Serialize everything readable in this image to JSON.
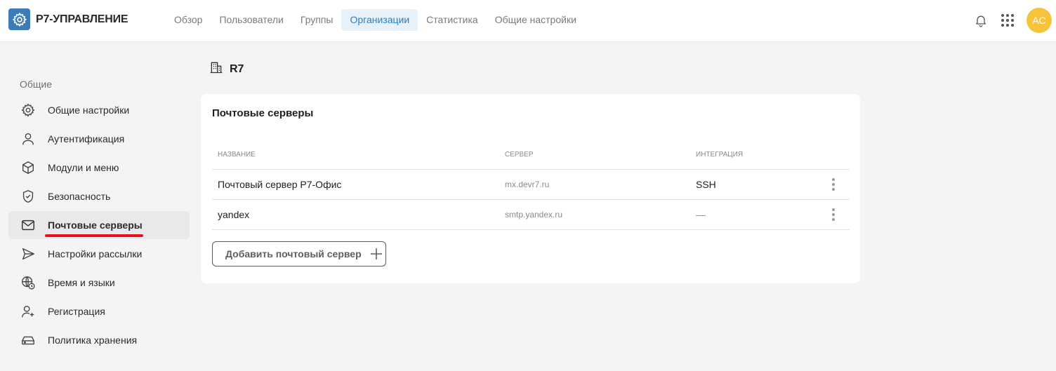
{
  "app": {
    "name": "Р7-УПРАВЛЕНИЕ",
    "brand_color": "#3d7bb5"
  },
  "nav": {
    "items": [
      {
        "label": "Обзор",
        "active": false
      },
      {
        "label": "Пользователи",
        "active": false
      },
      {
        "label": "Группы",
        "active": false
      },
      {
        "label": "Организации",
        "active": true
      },
      {
        "label": "Статистика",
        "active": false
      },
      {
        "label": "Общие настройки",
        "active": false
      }
    ],
    "active_color": "#2b7fc2"
  },
  "header": {
    "avatar_initials": "АС",
    "avatar_color": "#f6c43b",
    "icons": [
      "bell-icon",
      "apps-grid-icon"
    ]
  },
  "sidebar": {
    "section_title": "Общие",
    "items": [
      {
        "label": "Общие настройки",
        "icon": "gear-icon",
        "active": false
      },
      {
        "label": "Аутентификация",
        "icon": "user-icon",
        "active": false
      },
      {
        "label": "Модули и меню",
        "icon": "cube-icon",
        "active": false
      },
      {
        "label": "Безопасность",
        "icon": "shield-icon",
        "active": false
      },
      {
        "label": "Почтовые серверы",
        "icon": "mail-icon",
        "active": true
      },
      {
        "label": "Настройки рассылки",
        "icon": "send-icon",
        "active": false
      },
      {
        "label": "Время и языки",
        "icon": "globe-clock-icon",
        "active": false
      },
      {
        "label": "Регистрация",
        "icon": "user-plus-icon",
        "active": false
      },
      {
        "label": "Политика хранения",
        "icon": "storage-icon",
        "active": false
      }
    ],
    "highlight_color": "#e1141d"
  },
  "organization": {
    "name": "R7"
  },
  "mail_servers": {
    "title": "Почтовые серверы",
    "columns": [
      "НАЗВАНИЕ",
      "СЕРВЕР",
      "ИНТЕГРАЦИЯ"
    ],
    "rows": [
      {
        "name": "Почтовый сервер Р7-Офис",
        "server": "mx.devr7.ru",
        "integration": "SSH"
      },
      {
        "name": "yandex",
        "server": "smtp.yandex.ru",
        "integration": "—"
      }
    ],
    "add_button_label": "Добавить почтовый сервер"
  }
}
